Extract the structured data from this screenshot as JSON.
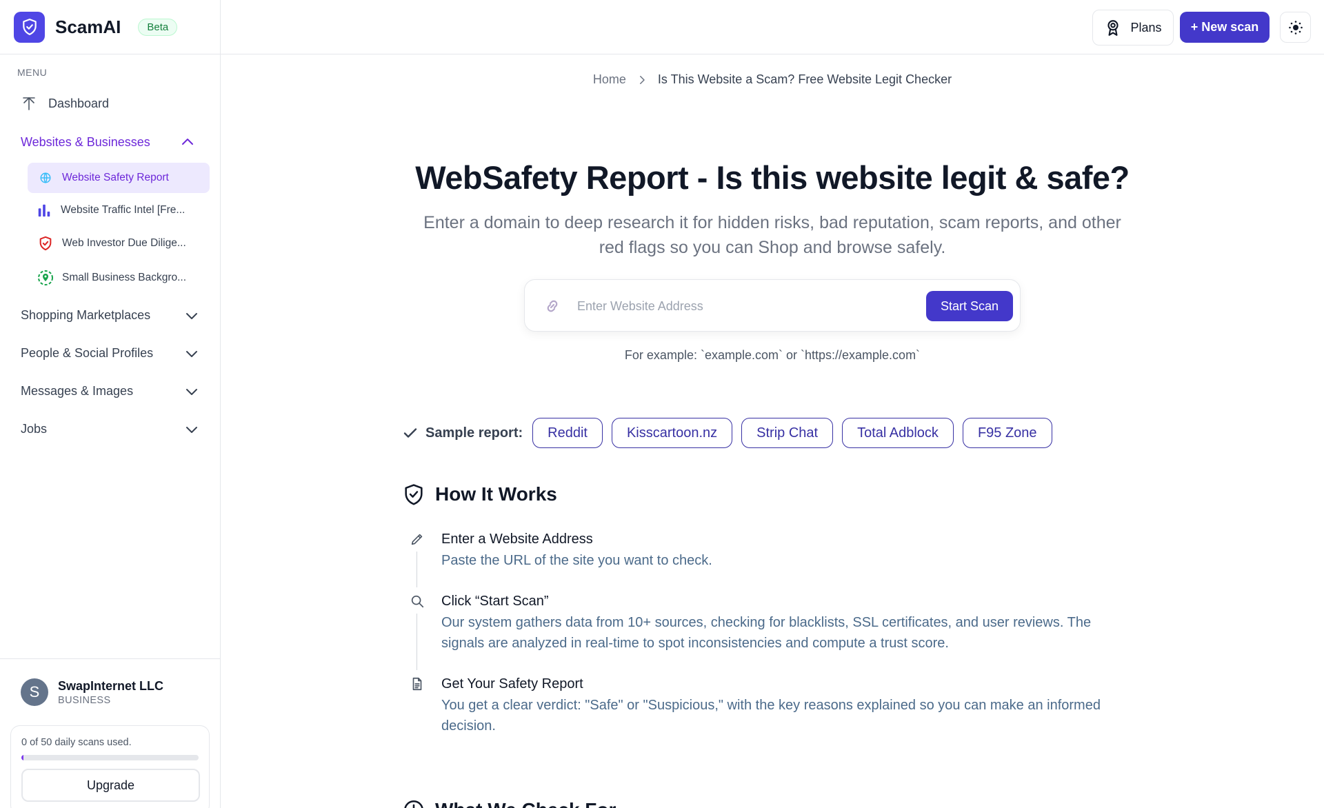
{
  "brand": {
    "name": "ScamAI",
    "badge": "Beta"
  },
  "sidebar": {
    "menu_label": "MENU",
    "dashboard": "Dashboard",
    "websites_section": "Websites & Businesses",
    "sub_items": [
      {
        "label": "Website Safety Report",
        "icon": "globe-icon"
      },
      {
        "label": "Website Traffic Intel [Fre...",
        "icon": "bar-chart-icon"
      },
      {
        "label": "Web Investor Due Dilige...",
        "icon": "shield-icon"
      },
      {
        "label": "Small Business Backgro...",
        "icon": "location-pin-icon"
      }
    ],
    "sections": [
      {
        "label": "Shopping Marketplaces"
      },
      {
        "label": "People & Social Profiles"
      },
      {
        "label": "Messages & Images"
      },
      {
        "label": "Jobs"
      }
    ],
    "user": {
      "initial": "S",
      "name": "SwapInternet LLC",
      "type": "BUSINESS"
    },
    "usage": {
      "text": "0 of 50 daily scans used.",
      "fraction": 0.01
    },
    "upgrade_label": "Upgrade"
  },
  "header": {
    "plans_label": "Plans",
    "new_scan_label": "+ New scan"
  },
  "breadcrumb": {
    "home": "Home",
    "current": "Is This Website a Scam? Free Website Legit Checker"
  },
  "hero": {
    "title": "WebSafety Report - Is this website legit & safe?",
    "subtitle": "Enter a domain to deep research it for hidden risks, bad reputation, scam reports, and other red flags so you can Shop and browse safely."
  },
  "search": {
    "placeholder": "Enter Website Address",
    "value": "",
    "button_label": "Start Scan",
    "example": "For example: `example.com` or `https://example.com`"
  },
  "samples": {
    "label": "Sample report:",
    "items": [
      "Reddit",
      "Kisscartoon.nz",
      "Strip Chat",
      "Total Adblock",
      "F95 Zone"
    ]
  },
  "how_it_works": {
    "title": "How It Works",
    "steps": [
      {
        "icon": "pencil-icon",
        "title": "Enter a Website Address",
        "desc": "Paste the URL of the site you want to check."
      },
      {
        "icon": "search-icon",
        "title": "Click “Start Scan”",
        "desc": "Our system gathers data from 10+ sources, checking for blacklists, SSL certificates, and user reviews. The signals are analyzed in real-time to spot inconsistencies and compute a trust score."
      },
      {
        "icon": "document-icon",
        "title": "Get Your Safety Report",
        "desc": "You get a clear verdict: \"Safe\" or \"Suspicious,\" with the key reasons explained so you can make an informed decision."
      }
    ]
  },
  "what_we_check": {
    "title": "What We Check For"
  },
  "colors": {
    "accent": "#4338ca",
    "sidebar_active": "#6d28d9",
    "active_bg": "#ede9fe"
  }
}
